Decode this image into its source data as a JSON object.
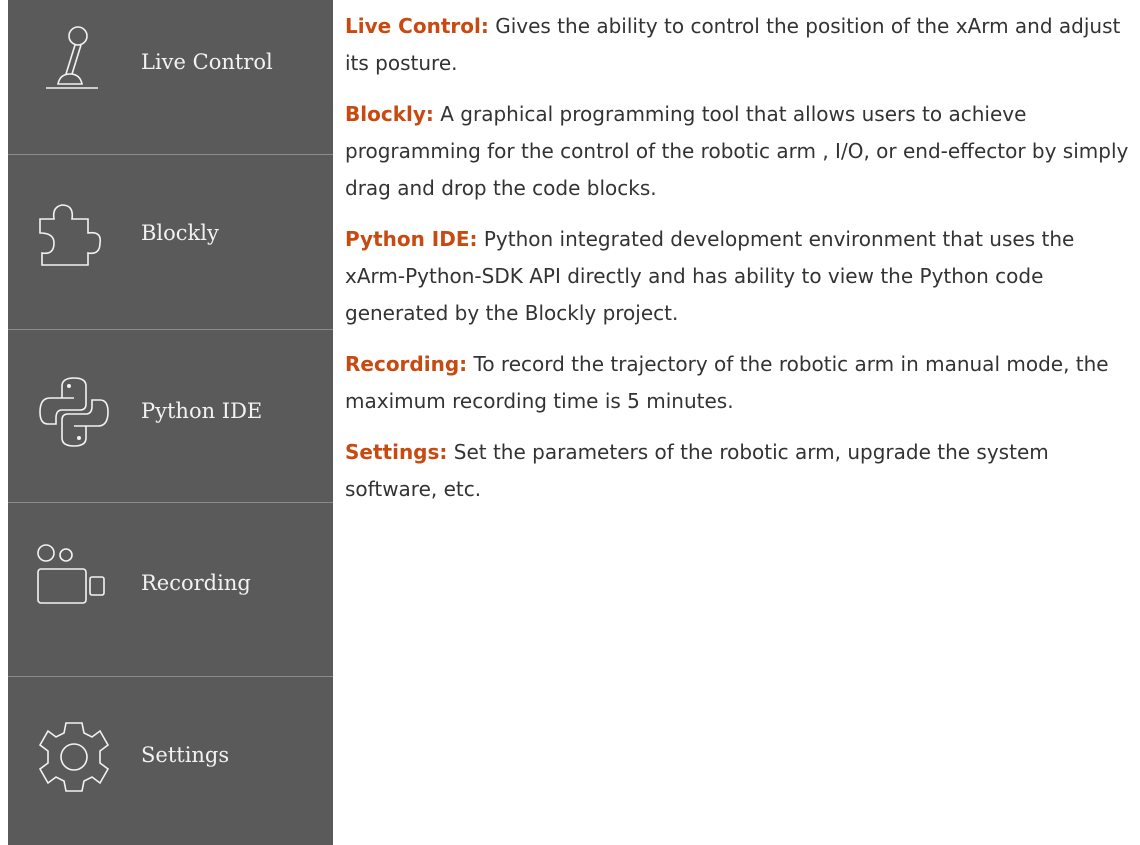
{
  "sidebar": {
    "items": [
      {
        "label": "Live Control",
        "icon": "joystick-icon"
      },
      {
        "label": "Blockly",
        "icon": "puzzle-piece-icon"
      },
      {
        "label": "Python IDE",
        "icon": "python-logo-icon"
      },
      {
        "label": "Recording",
        "icon": "video-camera-icon"
      },
      {
        "label": "Settings",
        "icon": "gear-icon"
      }
    ]
  },
  "descriptions": [
    {
      "term": "Live Control:",
      "text": "  Gives the ability to control the position of the xArm and adjust its posture."
    },
    {
      "term": "Blockly:",
      "text": "  A graphical programming tool that allows users to achieve programming for the control of the robotic arm , I/O, or end-effector by simply drag and drop the code blocks."
    },
    {
      "term": "Python IDE:",
      "text": "  Python integrated development environment that uses the xArm-Python-SDK API directly and has ability to view the Python code generated by the Blockly project."
    },
    {
      "term": "Recording:",
      "text": "  To record the trajectory of the robotic arm in manual mode, the maximum recording time is 5 minutes."
    },
    {
      "term": "Settings:",
      "text": " Set the parameters of the robotic arm, upgrade the system software, etc."
    }
  ],
  "colors": {
    "sidebar_bg": "#5b5a5a",
    "term": "#c94a10",
    "text": "#333333"
  }
}
